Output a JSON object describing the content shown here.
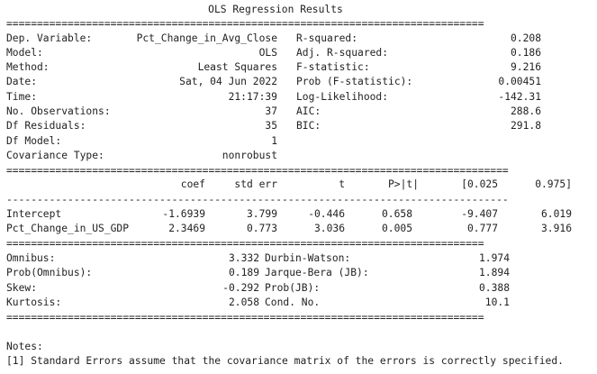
{
  "title": "OLS Regression Results",
  "header_left": [
    {
      "label": "Dep. Variable:",
      "value": "Pct_Change_in_Avg_Close"
    },
    {
      "label": "Model:",
      "value": "OLS"
    },
    {
      "label": "Method:",
      "value": "Least Squares"
    },
    {
      "label": "Date:",
      "value": "Sat, 04 Jun 2022"
    },
    {
      "label": "Time:",
      "value": "21:17:39"
    },
    {
      "label": "No. Observations:",
      "value": "37"
    },
    {
      "label": "Df Residuals:",
      "value": "35"
    },
    {
      "label": "Df Model:",
      "value": "1"
    },
    {
      "label": "Covariance Type:",
      "value": "nonrobust"
    }
  ],
  "header_right": [
    {
      "label": "R-squared:",
      "value": "0.208"
    },
    {
      "label": "Adj. R-squared:",
      "value": "0.186"
    },
    {
      "label": "F-statistic:",
      "value": "9.216"
    },
    {
      "label": "Prob (F-statistic):",
      "value": "0.00451"
    },
    {
      "label": "Log-Likelihood:",
      "value": "-142.31"
    },
    {
      "label": "AIC:",
      "value": "288.6"
    },
    {
      "label": "BIC:",
      "value": "291.8"
    }
  ],
  "coef_table": {
    "columns": [
      "coef",
      "std err",
      "t",
      "P>|t|",
      "[0.025",
      "0.975]"
    ],
    "rows": [
      {
        "name": "Intercept",
        "values": [
          "-1.6939",
          "3.799",
          "-0.446",
          "0.658",
          "-9.407",
          "6.019"
        ]
      },
      {
        "name": "Pct_Change_in_US_GDP",
        "values": [
          "2.3469",
          "0.773",
          "3.036",
          "0.005",
          "0.777",
          "3.916"
        ]
      }
    ]
  },
  "diagnostics_left": [
    {
      "label": "Omnibus:",
      "value": "3.332"
    },
    {
      "label": "Prob(Omnibus):",
      "value": "0.189"
    },
    {
      "label": "Skew:",
      "value": "-0.292"
    },
    {
      "label": "Kurtosis:",
      "value": "2.058"
    }
  ],
  "diagnostics_right": [
    {
      "label": "Durbin-Watson:",
      "value": "1.974"
    },
    {
      "label": "Jarque-Bera (JB):",
      "value": "1.894"
    },
    {
      "label": "Prob(JB):",
      "value": "0.388"
    },
    {
      "label": "Cond. No.",
      "value": "10.1"
    }
  ],
  "notes_heading": "Notes:",
  "notes": [
    "[1] Standard Errors assume that the covariance matrix of the errors is correctly specified."
  ]
}
